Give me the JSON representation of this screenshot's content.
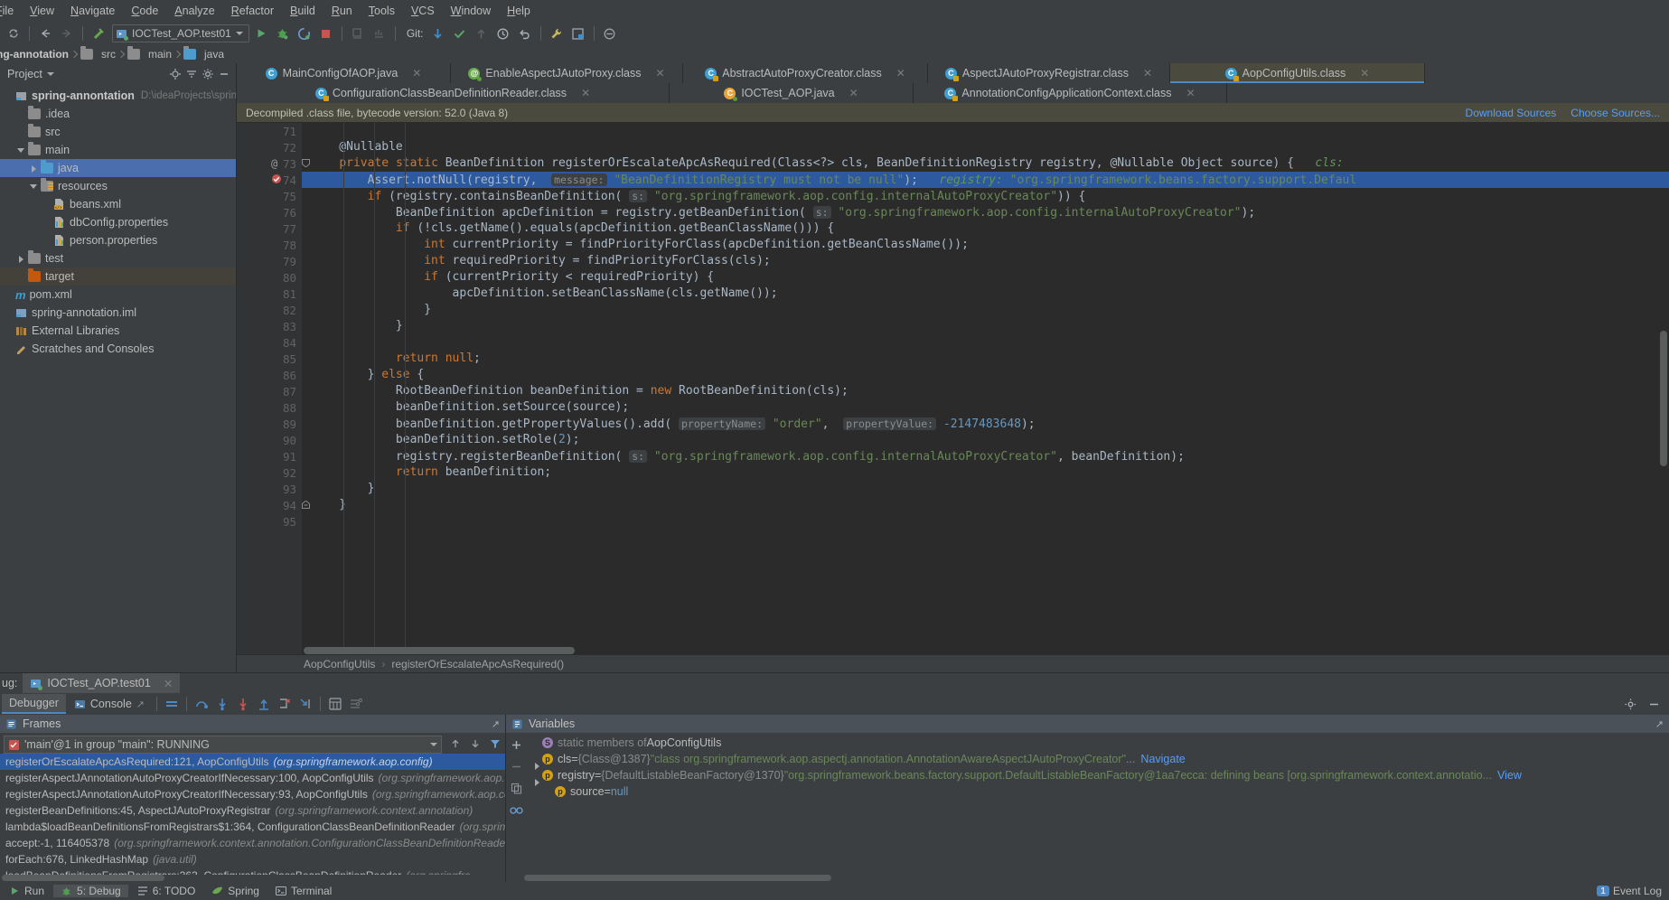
{
  "menubar": {
    "items": [
      "File",
      "View",
      "Navigate",
      "Code",
      "Analyze",
      "Refactor",
      "Build",
      "Run",
      "Tools",
      "VCS",
      "Window",
      "Help"
    ]
  },
  "toolbar": {
    "run_config": "IOCTest_AOP.test01",
    "git_label": "Git:",
    "icons": [
      "sync-icon",
      "back-arrow-icon",
      "forward-arrow-icon",
      "build-hammer-icon",
      "run-icon",
      "debug-icon",
      "run-coverage-icon",
      "stop-icon",
      "deploy-icon",
      "profile-icon",
      "git-update-icon",
      "git-commit-icon",
      "git-push-icon",
      "history-icon",
      "rollback-icon",
      "settings-wrench-icon",
      "layout-icon",
      "search-everywhere-icon"
    ]
  },
  "breadcrumb": {
    "items": [
      "ng-annotation",
      "src",
      "main",
      "java"
    ]
  },
  "project_panel": {
    "title": "Project",
    "tree": [
      {
        "label": "spring-annontation",
        "path": "D:\\ideaProjects\\spring-learnin",
        "indent": 0,
        "icon": "module-icon",
        "arrow": "none",
        "bold": true
      },
      {
        "label": ".idea",
        "indent": 1,
        "icon": "folder-gray",
        "arrow": "none"
      },
      {
        "label": "src",
        "indent": 1,
        "icon": "folder-gray",
        "arrow": "none"
      },
      {
        "label": "main",
        "indent": 1,
        "icon": "folder-gray",
        "arrow": "down"
      },
      {
        "label": "java",
        "indent": 2,
        "icon": "folder-blue",
        "arrow": "right",
        "selected": true
      },
      {
        "label": "resources",
        "indent": 2,
        "icon": "folder-resources",
        "arrow": "down"
      },
      {
        "label": "beans.xml",
        "indent": 3,
        "icon": "xml-file-icon",
        "arrow": "none"
      },
      {
        "label": "dbConfig.properties",
        "indent": 3,
        "icon": "properties-file-icon",
        "arrow": "none"
      },
      {
        "label": "person.properties",
        "indent": 3,
        "icon": "properties-file-icon",
        "arrow": "none"
      },
      {
        "label": "test",
        "indent": 1,
        "icon": "folder-gray",
        "arrow": "right"
      },
      {
        "label": "target",
        "indent": 1,
        "icon": "folder-orange",
        "arrow": "none",
        "dim": true
      },
      {
        "label": "pom.xml",
        "indent": 0,
        "icon": "maven-icon",
        "arrow": "none"
      },
      {
        "label": "spring-annotation.iml",
        "indent": 0,
        "icon": "iml-file-icon",
        "arrow": "none"
      },
      {
        "label": "External Libraries",
        "indent": 0,
        "icon": "library-icon",
        "arrow": "none"
      },
      {
        "label": "Scratches and Consoles",
        "indent": 0,
        "icon": "scratches-icon",
        "arrow": "none"
      }
    ]
  },
  "editor": {
    "tabs_row1": [
      {
        "label": "MainConfigOfAOP.java",
        "icon": "java-class-icon",
        "state": "normal"
      },
      {
        "label": "EnableAspectJAutoProxy.class",
        "icon": "annotation-icon",
        "state": "normal"
      },
      {
        "label": "AbstractAutoProxyCreator.class",
        "icon": "class-locked-icon",
        "state": "normal"
      },
      {
        "label": "AspectJAutoProxyRegistrar.class",
        "icon": "class-locked-icon",
        "state": "normal"
      },
      {
        "label": "AopConfigUtils.class",
        "icon": "class-locked-icon",
        "state": "selected"
      }
    ],
    "tabs_row2": [
      {
        "label": "ConfigurationClassBeanDefinitionReader.class",
        "icon": "class-locked-icon",
        "state": "normal"
      },
      {
        "label": "IOCTest_AOP.java",
        "icon": "test-class-icon",
        "state": "normal"
      },
      {
        "label": "AnnotationConfigApplicationContext.class",
        "icon": "class-locked-icon",
        "state": "normal"
      }
    ],
    "notification": {
      "text": "Decompiled .class file, bytecode version: 52.0 (Java 8)",
      "links": [
        "Download Sources",
        "Choose Sources..."
      ]
    },
    "breadcrumb_bottom": [
      "AopConfigUtils",
      "registerOrEscalateApcAsRequired()"
    ],
    "first_line_number": 71,
    "lines": [
      {
        "n": 71,
        "text": ""
      },
      {
        "n": 72,
        "text": "    @Nullable"
      },
      {
        "n": 73,
        "text": "    private static BeanDefinition registerOrEscalateApcAsRequired(Class<?> cls, BeanDefinitionRegistry registry, @Nullable Object source) {   cls:",
        "marker": "@",
        "fold": "start"
      },
      {
        "n": 74,
        "text": "        Assert.notNull(registry,  message: \"BeanDefinitionRegistry must not be null\");   registry: \"org.springframework.beans.factory.support.Defaul",
        "marker": "breakpoint",
        "highlight": true
      },
      {
        "n": 75,
        "text": "        if (registry.containsBeanDefinition( s: \"org.springframework.aop.config.internalAutoProxyCreator\")) {"
      },
      {
        "n": 76,
        "text": "            BeanDefinition apcDefinition = registry.getBeanDefinition( s: \"org.springframework.aop.config.internalAutoProxyCreator\");"
      },
      {
        "n": 77,
        "text": "            if (!cls.getName().equals(apcDefinition.getBeanClassName())) {"
      },
      {
        "n": 78,
        "text": "                int currentPriority = findPriorityForClass(apcDefinition.getBeanClassName());"
      },
      {
        "n": 79,
        "text": "                int requiredPriority = findPriorityForClass(cls);"
      },
      {
        "n": 80,
        "text": "                if (currentPriority < requiredPriority) {"
      },
      {
        "n": 81,
        "text": "                    apcDefinition.setBeanClassName(cls.getName());"
      },
      {
        "n": 82,
        "text": "                }"
      },
      {
        "n": 83,
        "text": "            }"
      },
      {
        "n": 84,
        "text": ""
      },
      {
        "n": 85,
        "text": "            return null;"
      },
      {
        "n": 86,
        "text": "        } else {"
      },
      {
        "n": 87,
        "text": "            RootBeanDefinition beanDefinition = new RootBeanDefinition(cls);"
      },
      {
        "n": 88,
        "text": "            beanDefinition.setSource(source);"
      },
      {
        "n": 89,
        "text": "            beanDefinition.getPropertyValues().add( propertyName: \"order\",  propertyValue: -2147483648);"
      },
      {
        "n": 90,
        "text": "            beanDefinition.setRole(2);"
      },
      {
        "n": 91,
        "text": "            registry.registerBeanDefinition( s: \"org.springframework.aop.config.internalAutoProxyCreator\", beanDefinition);"
      },
      {
        "n": 92,
        "text": "            return beanDefinition;"
      },
      {
        "n": 93,
        "text": "        }"
      },
      {
        "n": 94,
        "text": "    }",
        "fold": "end"
      },
      {
        "n": 95,
        "text": ""
      }
    ]
  },
  "debug": {
    "tool_label": "ug:",
    "session_tab": "IOCTest_AOP.test01",
    "subtabs": [
      {
        "label": "Debugger",
        "active": true
      },
      {
        "label": "Console",
        "active": false
      }
    ],
    "toolbar_icons": [
      "step-over-icon",
      "step-into-icon",
      "force-step-into-icon",
      "step-out-icon",
      "drop-frame-icon",
      "run-to-cursor-icon",
      "evaluate-expression-icon",
      "settings-icon"
    ],
    "frames": {
      "title": "Frames",
      "thread": "'main'@1 in group \"main\": RUNNING",
      "items": [
        {
          "method": "registerOrEscalateApcAsRequired:121, AopConfigUtils",
          "pkg": "(org.springframework.aop.config)",
          "selected": true
        },
        {
          "method": "registerAspectJAnnotationAutoProxyCreatorIfNecessary:100, AopConfigUtils",
          "pkg": "(org.springframework.aop.config"
        },
        {
          "method": "registerAspectJAnnotationAutoProxyCreatorIfNecessary:93, AopConfigUtils",
          "pkg": "(org.springframework.aop.config)"
        },
        {
          "method": "registerBeanDefinitions:45, AspectJAutoProxyRegistrar",
          "pkg": "(org.springframework.context.annotation)"
        },
        {
          "method": "lambda$loadBeanDefinitionsFromRegistrars$1:364, ConfigurationClassBeanDefinitionReader",
          "pkg": "(org.springframe"
        },
        {
          "method": "accept:-1, 116405378",
          "pkg": "(org.springframework.context.annotation.ConfigurationClassBeanDefinitionReader$$Lam"
        },
        {
          "method": "forEach:676, LinkedHashMap",
          "pkg": "(java.util)"
        },
        {
          "method": "loadBeanDefinitionsFromRegistrars:363, ConfigurationClassBeanDefinitionReader",
          "pkg": "(org.springfra"
        }
      ]
    },
    "variables": {
      "title": "Variables",
      "items": [
        {
          "indent": 0,
          "arrow": "none",
          "icon": "none",
          "text_static": "static members of AopConfigUtils",
          "kind": "static"
        },
        {
          "indent": 0,
          "arrow": "right",
          "icon": "p",
          "name": "cls",
          "eq": " = ",
          "type": "{Class@1387}",
          "value": "\"class org.springframework.aop.aspectj.annotation.AnnotationAwareAspectJAutoProxyCreator\"",
          "ellipsis": "...",
          "link": "Navigate"
        },
        {
          "indent": 0,
          "arrow": "right",
          "icon": "p",
          "name": "registry",
          "eq": " = ",
          "type": "{DefaultListableBeanFactory@1370}",
          "value": "\"org.springframework.beans.factory.support.DefaultListableBeanFactory@1aa7ecca: defining beans [org.springframework.context.annotatio...",
          "link": "View"
        },
        {
          "indent": 1,
          "arrow": "none",
          "icon": "p",
          "name": "source",
          "eq": " = ",
          "value_plain": "null"
        }
      ]
    }
  },
  "statusbar": {
    "items": [
      {
        "label": "Run",
        "icon": "run-tool-icon"
      },
      {
        "label": "5: Debug",
        "icon": "debug-tool-icon",
        "active": true
      },
      {
        "label": "6: TODO",
        "icon": "todo-icon"
      },
      {
        "label": "Spring",
        "icon": "spring-icon"
      },
      {
        "label": "Terminal",
        "icon": "terminal-icon"
      }
    ],
    "right": {
      "event_log": "Event Log",
      "event_count": "1"
    }
  },
  "colors": {
    "accent": "#4b6eaf",
    "selection": "#2d5a9e",
    "link": "#589df6",
    "keyword": "#cc7832",
    "string": "#6a8759",
    "number": "#6897bb"
  }
}
